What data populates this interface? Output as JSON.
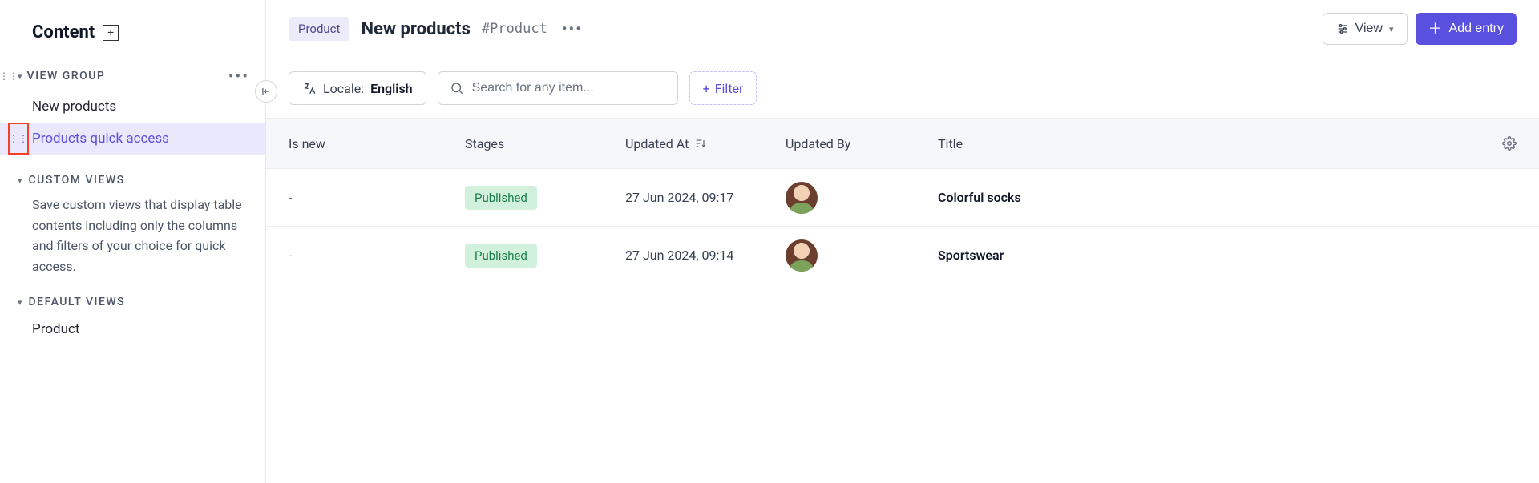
{
  "sidebar": {
    "title": "Content",
    "view_group_label": "VIEW GROUP",
    "items": [
      {
        "label": "New products"
      },
      {
        "label": "Products quick access"
      }
    ],
    "custom_views_label": "CUSTOM VIEWS",
    "custom_views_desc": "Save custom views that display table contents including only the columns and filters of your choice for quick access.",
    "default_views_label": "DEFAULT VIEWS",
    "default_views_items": [
      {
        "label": "Product"
      }
    ]
  },
  "header": {
    "chip": "Product",
    "title": "New products",
    "hash": "#Product",
    "view_button": "View",
    "add_button": "Add entry"
  },
  "toolbar": {
    "locale_label": "Locale:",
    "locale_value": "English",
    "search_placeholder": "Search for any item...",
    "filter_label": "Filter"
  },
  "table": {
    "columns": {
      "is_new": "Is new",
      "stages": "Stages",
      "updated_at": "Updated At",
      "updated_by": "Updated By",
      "title": "Title"
    },
    "rows": [
      {
        "is_new": "-",
        "stage": "Published",
        "updated_at": "27 Jun 2024, 09:17",
        "title": "Colorful socks"
      },
      {
        "is_new": "-",
        "stage": "Published",
        "updated_at": "27 Jun 2024, 09:14",
        "title": "Sportswear"
      }
    ]
  }
}
